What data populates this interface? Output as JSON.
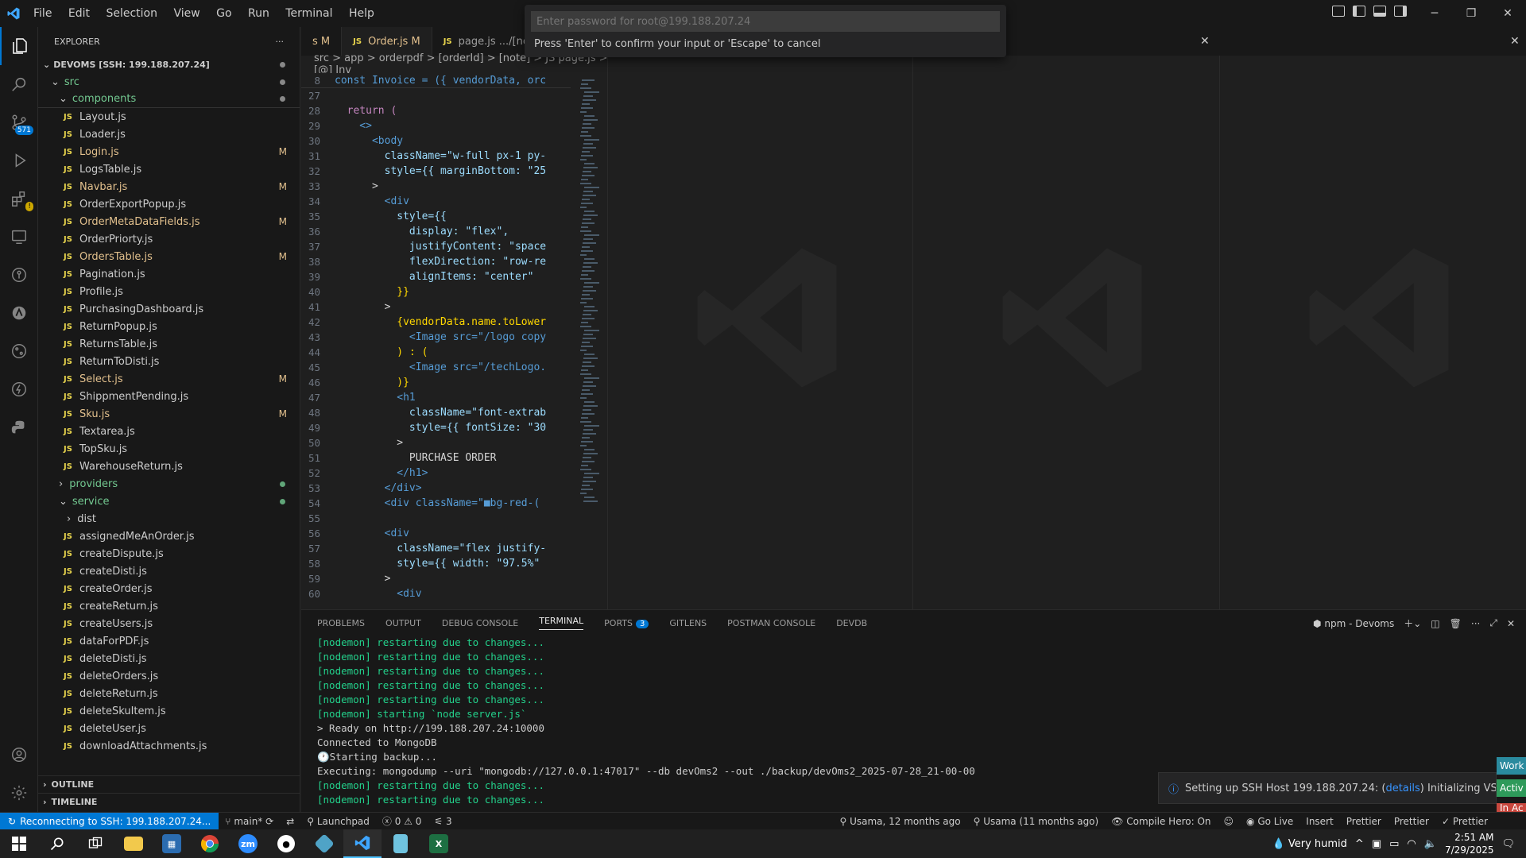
{
  "menu": [
    "File",
    "Edit",
    "Selection",
    "View",
    "Go",
    "Run",
    "Terminal",
    "Help"
  ],
  "quick_input": {
    "placeholder": "Enter password for root@199.188.207.24",
    "message": "Press 'Enter' to confirm your input or 'Escape' to cancel"
  },
  "activity": {
    "source_control_badge": "571"
  },
  "explorer": {
    "title": "EXPLORER",
    "root": "DEVOMS [SSH: 199.188.207.24]",
    "src": "src",
    "components": "components",
    "files": [
      {
        "name": "Layout.js",
        "mod": ""
      },
      {
        "name": "Loader.js",
        "mod": ""
      },
      {
        "name": "Login.js",
        "mod": "M"
      },
      {
        "name": "LogsTable.js",
        "mod": ""
      },
      {
        "name": "Navbar.js",
        "mod": "M"
      },
      {
        "name": "OrderExportPopup.js",
        "mod": ""
      },
      {
        "name": "OrderMetaDataFields.js",
        "mod": "M"
      },
      {
        "name": "OrderPriorty.js",
        "mod": ""
      },
      {
        "name": "OrdersTable.js",
        "mod": "M"
      },
      {
        "name": "Pagination.js",
        "mod": ""
      },
      {
        "name": "Profile.js",
        "mod": ""
      },
      {
        "name": "PurchasingDashboard.js",
        "mod": ""
      },
      {
        "name": "ReturnPopup.js",
        "mod": ""
      },
      {
        "name": "ReturnsTable.js",
        "mod": ""
      },
      {
        "name": "ReturnToDisti.js",
        "mod": ""
      },
      {
        "name": "Select.js",
        "mod": "M"
      },
      {
        "name": "ShippmentPending.js",
        "mod": ""
      },
      {
        "name": "Sku.js",
        "mod": "M"
      },
      {
        "name": "Textarea.js",
        "mod": ""
      },
      {
        "name": "TopSku.js",
        "mod": ""
      },
      {
        "name": "WarehouseReturn.js",
        "mod": ""
      }
    ],
    "providers": "providers",
    "service": "service",
    "dist": "dist",
    "service_files": [
      "assignedMeAnOrder.js",
      "createDispute.js",
      "createDisti.js",
      "createOrder.js",
      "createReturn.js",
      "createUsers.js",
      "dataForPDF.js",
      "deleteDisti.js",
      "deleteOrders.js",
      "deleteReturn.js",
      "deleteSkuItem.js",
      "deleteUser.js",
      "downloadAttachments.js"
    ],
    "outline": "OUTLINE",
    "timeline": "TIMELINE"
  },
  "tabs": [
    {
      "label": "s M"
    },
    {
      "label": "Order.js M"
    },
    {
      "label": "page.js .../[nc"
    }
  ],
  "breadcrumb": "src > app > orderpdf > [orderId] > [note] > JS page.js > [@] Inv",
  "sticky": {
    "ln": "8",
    "code": "const Invoice = ({ vendorData, orc"
  },
  "code": [
    {
      "ln": "27",
      "code": ""
    },
    {
      "ln": "28",
      "code": "  return ("
    },
    {
      "ln": "29",
      "code": "    <>"
    },
    {
      "ln": "30",
      "code": "      <body"
    },
    {
      "ln": "31",
      "code": "        className=\"w-full px-1 py-"
    },
    {
      "ln": "32",
      "code": "        style={{ marginBottom: \"25"
    },
    {
      "ln": "33",
      "code": "      >"
    },
    {
      "ln": "34",
      "code": "        <div"
    },
    {
      "ln": "35",
      "code": "          style={{"
    },
    {
      "ln": "36",
      "code": "            display: \"flex\","
    },
    {
      "ln": "37",
      "code": "            justifyContent: \"space"
    },
    {
      "ln": "38",
      "code": "            flexDirection: \"row-re"
    },
    {
      "ln": "39",
      "code": "            alignItems: \"center\""
    },
    {
      "ln": "40",
      "code": "          }}"
    },
    {
      "ln": "41",
      "code": "        >"
    },
    {
      "ln": "42",
      "code": "          {vendorData.name.toLower"
    },
    {
      "ln": "43",
      "code": "            <Image src=\"/logo copy"
    },
    {
      "ln": "44",
      "code": "          ) : ("
    },
    {
      "ln": "45",
      "code": "            <Image src=\"/techLogo."
    },
    {
      "ln": "46",
      "code": "          )}"
    },
    {
      "ln": "47",
      "code": "          <h1"
    },
    {
      "ln": "48",
      "code": "            className=\"font-extrab"
    },
    {
      "ln": "49",
      "code": "            style={{ fontSize: \"30"
    },
    {
      "ln": "50",
      "code": "          >"
    },
    {
      "ln": "51",
      "code": "            PURCHASE ORDER"
    },
    {
      "ln": "52",
      "code": "          </h1>"
    },
    {
      "ln": "53",
      "code": "        </div>"
    },
    {
      "ln": "54",
      "code": "        <div className=\"■bg-red-("
    },
    {
      "ln": "55",
      "code": ""
    },
    {
      "ln": "56",
      "code": "        <div"
    },
    {
      "ln": "57",
      "code": "          className=\"flex justify-"
    },
    {
      "ln": "58",
      "code": "          style={{ width: \"97.5%\""
    },
    {
      "ln": "59",
      "code": "        >"
    },
    {
      "ln": "60",
      "code": "          <div"
    }
  ],
  "panel": {
    "tabs": [
      "PROBLEMS",
      "OUTPUT",
      "DEBUG CONSOLE",
      "TERMINAL",
      "PORTS",
      "GITLENS",
      "POSTMAN CONSOLE",
      "DEVDB"
    ],
    "ports_badge": "3",
    "terminal_name": "npm - Devoms",
    "lines": [
      {
        "t": "[nodemon] restarting due to changes...",
        "c": "g"
      },
      {
        "t": "[nodemon] restarting due to changes...",
        "c": "g"
      },
      {
        "t": "[nodemon] restarting due to changes...",
        "c": "g"
      },
      {
        "t": "[nodemon] restarting due to changes...",
        "c": "g"
      },
      {
        "t": "[nodemon] restarting due to changes...",
        "c": "g"
      },
      {
        "t": "[nodemon] starting `node server.js`",
        "c": "g"
      },
      {
        "t": "> Ready on http://199.188.207.24:10000",
        "c": "w"
      },
      {
        "t": "Connected to MongoDB",
        "c": "w"
      },
      {
        "t": "🕐Starting backup...",
        "c": "w"
      },
      {
        "t": "Executing: mongodump --uri \"mongodb://127.0.0.1:47017\" --db devOms2 --out ./backup/devOms2_2025-07-28_21-00-00",
        "c": "w"
      },
      {
        "t": "[nodemon] restarting due to changes...",
        "c": "g"
      },
      {
        "t": "[nodemon] restarting due to changes...",
        "c": "g"
      }
    ]
  },
  "notification": {
    "text": "Setting up SSH Host 199.188.207.24: (",
    "link": "details",
    "rest": ") Initializing VS Code Se"
  },
  "side_buttons": [
    "Work",
    "Activ",
    "In Ac"
  ],
  "status": {
    "remote": "Reconnecting to SSH: 199.188.207.24...",
    "branch": "main*",
    "launchpad": "Launchpad",
    "errors": "0",
    "warnings": "0",
    "ports": "3",
    "blame": "Usama, 12 months ago",
    "author": "Usama (11 months ago)",
    "compile_hero": "Compile Hero: On",
    "go_live": "Go Live",
    "insert": "Insert",
    "prettier1": "Prettier",
    "prettier2": "Prettier",
    "prettier3": "Prettier"
  },
  "taskbar": {
    "weather": "Very humid",
    "time": "2:51 AM",
    "date": "7/29/2025",
    "zoom_label": "zm"
  }
}
